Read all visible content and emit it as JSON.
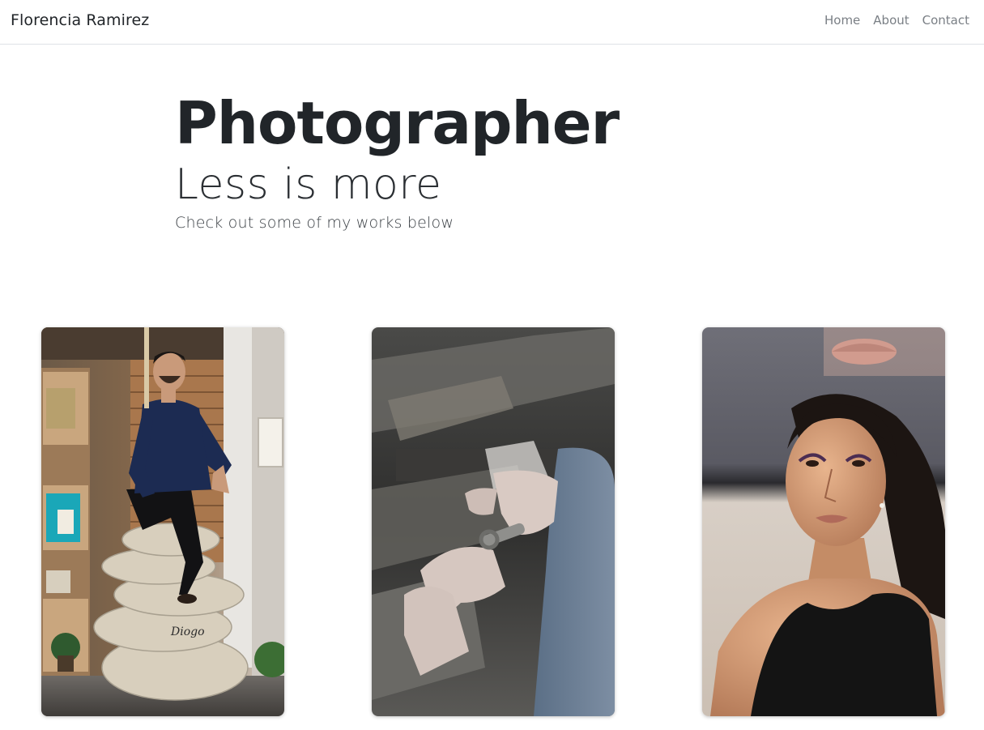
{
  "navbar": {
    "brand": "Florencia Ramirez",
    "links": [
      "Home",
      "About",
      "Contact"
    ]
  },
  "hero": {
    "title": "Photographer",
    "subtitle": "Less is more",
    "lead": "Check out some of my works below"
  },
  "gallery": {
    "photos": [
      {
        "subject": "man-sitting-on-coffee-sacks-photo"
      },
      {
        "subject": "hands-crafting-ring-photo"
      },
      {
        "subject": "woman-portrait-photo"
      }
    ]
  }
}
